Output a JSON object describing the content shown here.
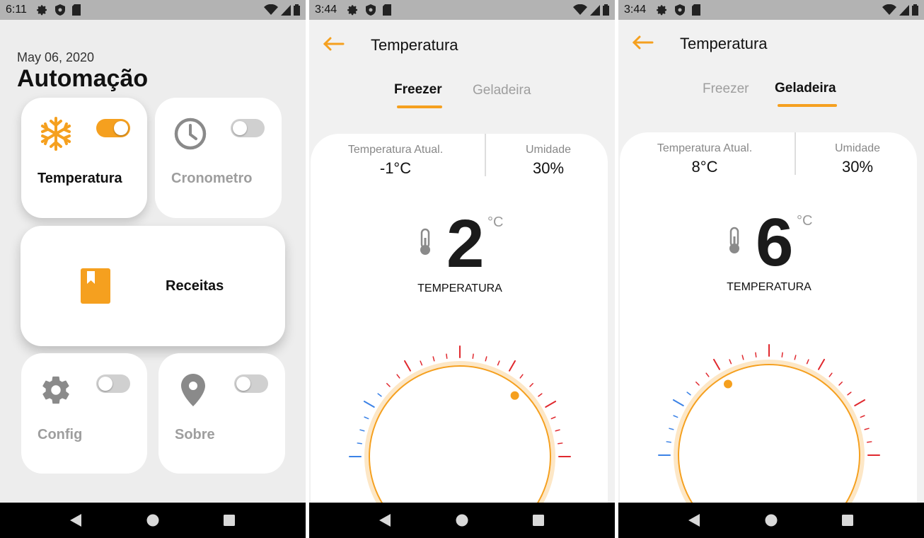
{
  "screens": [
    {
      "status": {
        "time": "6:11"
      },
      "date": "May 06, 2020",
      "title": "Automação",
      "cards": {
        "temperatura": {
          "label": "Temperatura",
          "icon": "snowflake-icon",
          "toggle_on": true
        },
        "cronometro": {
          "label": "Cronometro",
          "icon": "clock-icon",
          "toggle_on": false
        },
        "receitas": {
          "label": "Receitas",
          "icon": "recipe-book-icon"
        },
        "config": {
          "label": "Config",
          "icon": "gear-icon",
          "toggle_on": false
        },
        "sobre": {
          "label": "Sobre",
          "icon": "location-pin-icon",
          "toggle_on": false
        }
      }
    },
    {
      "status": {
        "time": "3:44"
      },
      "title": "Temperatura",
      "tabs": [
        {
          "label": "Freezer",
          "active": true
        },
        {
          "label": "Geladeira",
          "active": false
        }
      ],
      "stats": {
        "current_label": "Temperatura Atual.",
        "current_value": "-1°C",
        "humidity_label": "Umidade",
        "humidity_value": "30%"
      },
      "setpoint": "2",
      "unit": "°C",
      "caption": "TEMPERATURA",
      "dial": {
        "knob_angle_deg": 42
      }
    },
    {
      "status": {
        "time": "3:44"
      },
      "title": "Temperatura",
      "tabs": [
        {
          "label": "Freezer",
          "active": false
        },
        {
          "label": "Geladeira",
          "active": true
        }
      ],
      "stats": {
        "current_label": "Temperatura Atual.",
        "current_value": "8°C",
        "humidity_label": "Umidade",
        "humidity_value": "30%"
      },
      "setpoint": "6",
      "unit": "°C",
      "caption": "TEMPERATURA",
      "dial": {
        "knob_angle_deg": -30
      }
    }
  ],
  "colors": {
    "accent": "#f5a01f",
    "cold": "#3b82e6",
    "hot": "#e0282e",
    "inactive_text": "#9e9e9e"
  }
}
